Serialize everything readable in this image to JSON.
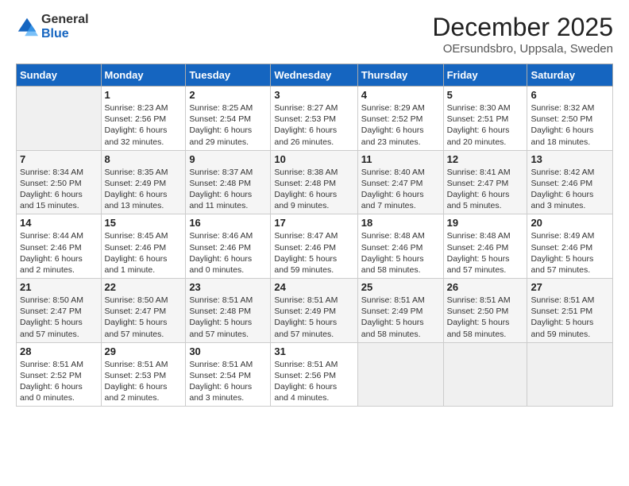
{
  "logo": {
    "general": "General",
    "blue": "Blue"
  },
  "title": "December 2025",
  "subtitle": "OErsundsbro, Uppsala, Sweden",
  "headers": [
    "Sunday",
    "Monday",
    "Tuesday",
    "Wednesday",
    "Thursday",
    "Friday",
    "Saturday"
  ],
  "weeks": [
    [
      {
        "day": "",
        "info": ""
      },
      {
        "day": "1",
        "info": "Sunrise: 8:23 AM\nSunset: 2:56 PM\nDaylight: 6 hours\nand 32 minutes."
      },
      {
        "day": "2",
        "info": "Sunrise: 8:25 AM\nSunset: 2:54 PM\nDaylight: 6 hours\nand 29 minutes."
      },
      {
        "day": "3",
        "info": "Sunrise: 8:27 AM\nSunset: 2:53 PM\nDaylight: 6 hours\nand 26 minutes."
      },
      {
        "day": "4",
        "info": "Sunrise: 8:29 AM\nSunset: 2:52 PM\nDaylight: 6 hours\nand 23 minutes."
      },
      {
        "day": "5",
        "info": "Sunrise: 8:30 AM\nSunset: 2:51 PM\nDaylight: 6 hours\nand 20 minutes."
      },
      {
        "day": "6",
        "info": "Sunrise: 8:32 AM\nSunset: 2:50 PM\nDaylight: 6 hours\nand 18 minutes."
      }
    ],
    [
      {
        "day": "7",
        "info": "Sunrise: 8:34 AM\nSunset: 2:50 PM\nDaylight: 6 hours\nand 15 minutes."
      },
      {
        "day": "8",
        "info": "Sunrise: 8:35 AM\nSunset: 2:49 PM\nDaylight: 6 hours\nand 13 minutes."
      },
      {
        "day": "9",
        "info": "Sunrise: 8:37 AM\nSunset: 2:48 PM\nDaylight: 6 hours\nand 11 minutes."
      },
      {
        "day": "10",
        "info": "Sunrise: 8:38 AM\nSunset: 2:48 PM\nDaylight: 6 hours\nand 9 minutes."
      },
      {
        "day": "11",
        "info": "Sunrise: 8:40 AM\nSunset: 2:47 PM\nDaylight: 6 hours\nand 7 minutes."
      },
      {
        "day": "12",
        "info": "Sunrise: 8:41 AM\nSunset: 2:47 PM\nDaylight: 6 hours\nand 5 minutes."
      },
      {
        "day": "13",
        "info": "Sunrise: 8:42 AM\nSunset: 2:46 PM\nDaylight: 6 hours\nand 3 minutes."
      }
    ],
    [
      {
        "day": "14",
        "info": "Sunrise: 8:44 AM\nSunset: 2:46 PM\nDaylight: 6 hours\nand 2 minutes."
      },
      {
        "day": "15",
        "info": "Sunrise: 8:45 AM\nSunset: 2:46 PM\nDaylight: 6 hours\nand 1 minute."
      },
      {
        "day": "16",
        "info": "Sunrise: 8:46 AM\nSunset: 2:46 PM\nDaylight: 6 hours\nand 0 minutes."
      },
      {
        "day": "17",
        "info": "Sunrise: 8:47 AM\nSunset: 2:46 PM\nDaylight: 5 hours\nand 59 minutes."
      },
      {
        "day": "18",
        "info": "Sunrise: 8:48 AM\nSunset: 2:46 PM\nDaylight: 5 hours\nand 58 minutes."
      },
      {
        "day": "19",
        "info": "Sunrise: 8:48 AM\nSunset: 2:46 PM\nDaylight: 5 hours\nand 57 minutes."
      },
      {
        "day": "20",
        "info": "Sunrise: 8:49 AM\nSunset: 2:46 PM\nDaylight: 5 hours\nand 57 minutes."
      }
    ],
    [
      {
        "day": "21",
        "info": "Sunrise: 8:50 AM\nSunset: 2:47 PM\nDaylight: 5 hours\nand 57 minutes."
      },
      {
        "day": "22",
        "info": "Sunrise: 8:50 AM\nSunset: 2:47 PM\nDaylight: 5 hours\nand 57 minutes."
      },
      {
        "day": "23",
        "info": "Sunrise: 8:51 AM\nSunset: 2:48 PM\nDaylight: 5 hours\nand 57 minutes."
      },
      {
        "day": "24",
        "info": "Sunrise: 8:51 AM\nSunset: 2:49 PM\nDaylight: 5 hours\nand 57 minutes."
      },
      {
        "day": "25",
        "info": "Sunrise: 8:51 AM\nSunset: 2:49 PM\nDaylight: 5 hours\nand 58 minutes."
      },
      {
        "day": "26",
        "info": "Sunrise: 8:51 AM\nSunset: 2:50 PM\nDaylight: 5 hours\nand 58 minutes."
      },
      {
        "day": "27",
        "info": "Sunrise: 8:51 AM\nSunset: 2:51 PM\nDaylight: 5 hours\nand 59 minutes."
      }
    ],
    [
      {
        "day": "28",
        "info": "Sunrise: 8:51 AM\nSunset: 2:52 PM\nDaylight: 6 hours\nand 0 minutes."
      },
      {
        "day": "29",
        "info": "Sunrise: 8:51 AM\nSunset: 2:53 PM\nDaylight: 6 hours\nand 2 minutes."
      },
      {
        "day": "30",
        "info": "Sunrise: 8:51 AM\nSunset: 2:54 PM\nDaylight: 6 hours\nand 3 minutes."
      },
      {
        "day": "31",
        "info": "Sunrise: 8:51 AM\nSunset: 2:56 PM\nDaylight: 6 hours\nand 4 minutes."
      },
      {
        "day": "",
        "info": ""
      },
      {
        "day": "",
        "info": ""
      },
      {
        "day": "",
        "info": ""
      }
    ]
  ]
}
